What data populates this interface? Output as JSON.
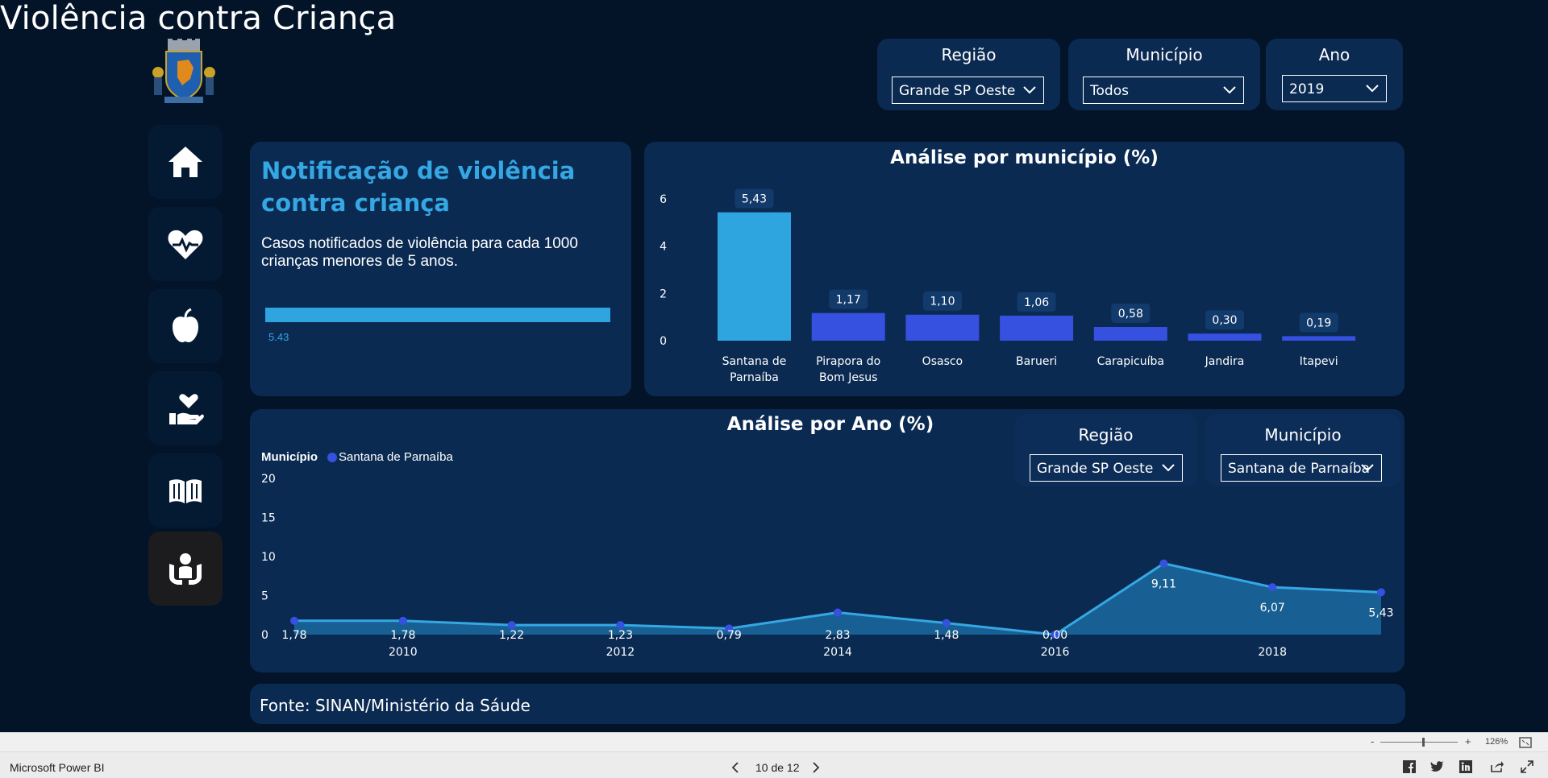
{
  "header": {
    "title": "Violência contra Criança"
  },
  "slicers_top": [
    {
      "label": "Região",
      "value": "Grande SP Oeste"
    },
    {
      "label": "Município",
      "value": "Todos"
    },
    {
      "label": "Ano",
      "value": "2019"
    }
  ],
  "nav": {
    "items": [
      {
        "icon": "home-icon"
      },
      {
        "icon": "heartbeat-icon"
      },
      {
        "icon": "apple-icon"
      },
      {
        "icon": "hand-heart-icon"
      },
      {
        "icon": "book-icon"
      },
      {
        "icon": "child-protection-icon",
        "active": true
      }
    ]
  },
  "kpi": {
    "title": "Notificação de violência contra criança",
    "description": "Casos notificados de violência para cada 1000 crianças menores de 5 anos.",
    "value": "5.43",
    "value_num": 5.43
  },
  "municipio_chart": {
    "title": "Análise por município (%)"
  },
  "ano_chart": {
    "title": "Análise por Ano (%)"
  },
  "slicers_inner": [
    {
      "label": "Região",
      "value": "Grande SP Oeste"
    },
    {
      "label": "Município",
      "value": "Santana de Parnaíba"
    }
  ],
  "footer": {
    "text": "Fonte:  SINAN/Ministério da Sáude"
  },
  "statusbar": {
    "app_name": "Microsoft Power BI",
    "page_indicator": "10 de 12",
    "zoom": "126%"
  },
  "colors": {
    "accent": "#35a7e3",
    "bar_primary": "#2fa5e0",
    "bar_secondary": "#3650e0",
    "panel": "#0a2a52",
    "background": "#031428"
  },
  "chart_data": [
    {
      "type": "bar",
      "title": "Análise por município (%)",
      "categories": [
        "Santana de Parnaíba",
        "Pirapora do Bom Jesus",
        "Osasco",
        "Barueri",
        "Carapicuíba",
        "Jandira",
        "Itapevi"
      ],
      "category_lines": [
        [
          "Santana de",
          "Parnaíba"
        ],
        [
          "Pirapora do",
          "Bom Jesus"
        ],
        [
          "Osasco"
        ],
        [
          "Barueri"
        ],
        [
          "Carapicuíba"
        ],
        [
          "Jandira"
        ],
        [
          "Itapevi"
        ]
      ],
      "values": [
        5.43,
        1.17,
        1.1,
        1.06,
        0.58,
        0.3,
        0.19
      ],
      "data_labels": [
        "5,43",
        "1,17",
        "1,10",
        "1,06",
        "0,58",
        "0,30",
        "0,19"
      ],
      "highlight_index": 0,
      "yticks": [
        "0",
        "2",
        "4",
        "6"
      ],
      "ylim": [
        0,
        6.2
      ]
    },
    {
      "type": "area",
      "title": "Análise por Ano (%)",
      "legend_title": "Município",
      "series": [
        {
          "name": "Santana de Parnaíba",
          "x": [
            2009,
            2010,
            2011,
            2012,
            2013,
            2014,
            2015,
            2016,
            2017,
            2018,
            2019
          ],
          "values": [
            1.78,
            1.78,
            1.22,
            1.23,
            0.79,
            2.83,
            1.48,
            0.0,
            9.11,
            6.07,
            5.43
          ],
          "data_labels": [
            "1,78",
            "1,78",
            "1,22",
            "1,23",
            "0,79",
            "2,83",
            "1,48",
            "0,00",
            "9,11",
            "6,07",
            "5,43"
          ]
        }
      ],
      "xticks": [
        "2010",
        "2012",
        "2014",
        "2016",
        "2018"
      ],
      "yticks": [
        "0",
        "5",
        "10",
        "15",
        "20"
      ],
      "ylim": [
        0,
        20
      ]
    }
  ]
}
